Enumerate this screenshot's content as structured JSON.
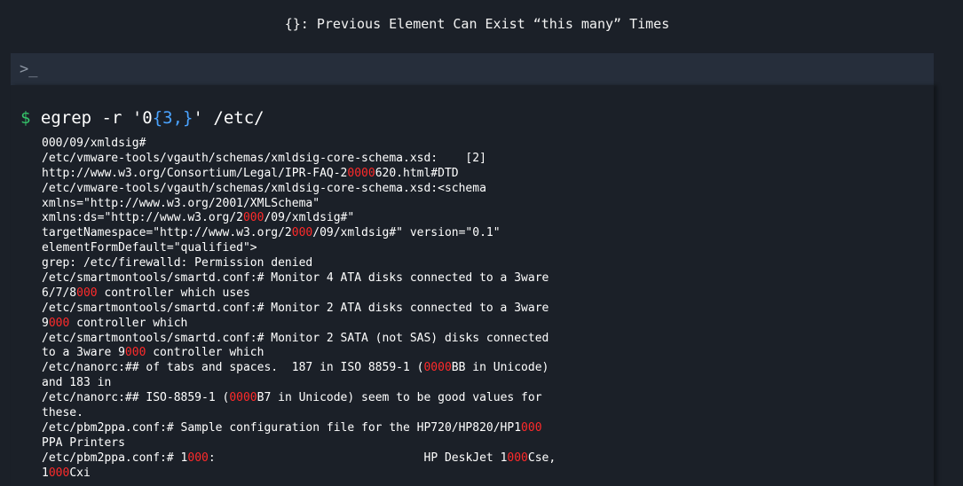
{
  "slide": {
    "title": "{}: Previous Element Can Exist “this many” Times"
  },
  "terminal": {
    "prompt_icon": "terminal-prompt-icon",
    "prompt_glyph": ">_",
    "command": {
      "dollar": "$",
      "text_before": " egrep -r '0",
      "quantifier": "{3,}",
      "text_after": "' /etc/"
    },
    "output_lines": [
      [
        {
          "t": "000/09/xmldsig#"
        }
      ],
      [
        {
          "t": "/etc/vmware-tools/vgauth/schemas/xmldsig-core-schema.xsd:    [2]"
        }
      ],
      [
        {
          "t": "http://www.w3.org/Consortium/Legal/IPR-FAQ-2"
        },
        {
          "t": "0000",
          "m": true
        },
        {
          "t": "620.html#DTD"
        }
      ],
      [
        {
          "t": "/etc/vmware-tools/vgauth/schemas/xmldsig-core-schema.xsd:<schema"
        }
      ],
      [
        {
          "t": "xmlns=\"http://www.w3.org/2001/XMLSchema\""
        }
      ],
      [
        {
          "t": "xmlns:ds=\"http://www.w3.org/2"
        },
        {
          "t": "000",
          "m": true
        },
        {
          "t": "/09/xmldsig#\""
        }
      ],
      [
        {
          "t": "targetNamespace=\"http://www.w3.org/2"
        },
        {
          "t": "000",
          "m": true
        },
        {
          "t": "/09/xmldsig#\" version=\"0.1\""
        }
      ],
      [
        {
          "t": "elementFormDefault=\"qualified\">"
        }
      ],
      [
        {
          "t": "grep: /etc/firewalld: Permission denied"
        }
      ],
      [
        {
          "t": "/etc/smartmontools/smartd.conf:# Monitor 4 ATA disks connected to a 3ware"
        }
      ],
      [
        {
          "t": "6/7/8"
        },
        {
          "t": "000",
          "m": true
        },
        {
          "t": " controller which uses"
        }
      ],
      [
        {
          "t": "/etc/smartmontools/smartd.conf:# Monitor 2 ATA disks connected to a 3ware"
        }
      ],
      [
        {
          "t": "9"
        },
        {
          "t": "000",
          "m": true
        },
        {
          "t": " controller which"
        }
      ],
      [
        {
          "t": "/etc/smartmontools/smartd.conf:# Monitor 2 SATA (not SAS) disks connected"
        }
      ],
      [
        {
          "t": "to a 3ware 9"
        },
        {
          "t": "000",
          "m": true
        },
        {
          "t": " controller which"
        }
      ],
      [
        {
          "t": "/etc/nanorc:## of tabs and spaces.  187 in ISO 8859-1 ("
        },
        {
          "t": "0000",
          "m": true
        },
        {
          "t": "BB in Unicode)"
        }
      ],
      [
        {
          "t": "and 183 in"
        }
      ],
      [
        {
          "t": "/etc/nanorc:## ISO-8859-1 ("
        },
        {
          "t": "0000",
          "m": true
        },
        {
          "t": "B7 in Unicode) seem to be good values for"
        }
      ],
      [
        {
          "t": "these."
        }
      ],
      [
        {
          "t": "/etc/pbm2ppa.conf:# Sample configuration file for the HP720/HP820/HP1"
        },
        {
          "t": "000",
          "m": true
        }
      ],
      [
        {
          "t": "PPA Printers"
        }
      ],
      [
        {
          "t": "/etc/pbm2ppa.conf:# 1"
        },
        {
          "t": "000",
          "m": true
        },
        {
          "t": ":                              HP DeskJet 1"
        },
        {
          "t": "000",
          "m": true
        },
        {
          "t": "Cse,"
        }
      ],
      [
        {
          "t": "1"
        },
        {
          "t": "000",
          "m": true
        },
        {
          "t": "Cxi"
        }
      ]
    ]
  },
  "colors": {
    "background": "#1b2028",
    "bar": "#262e3b",
    "dollar": "#35c46a",
    "quantifier": "#4aa3ff",
    "match": "#ff2a2a",
    "text": "#ffffff"
  }
}
